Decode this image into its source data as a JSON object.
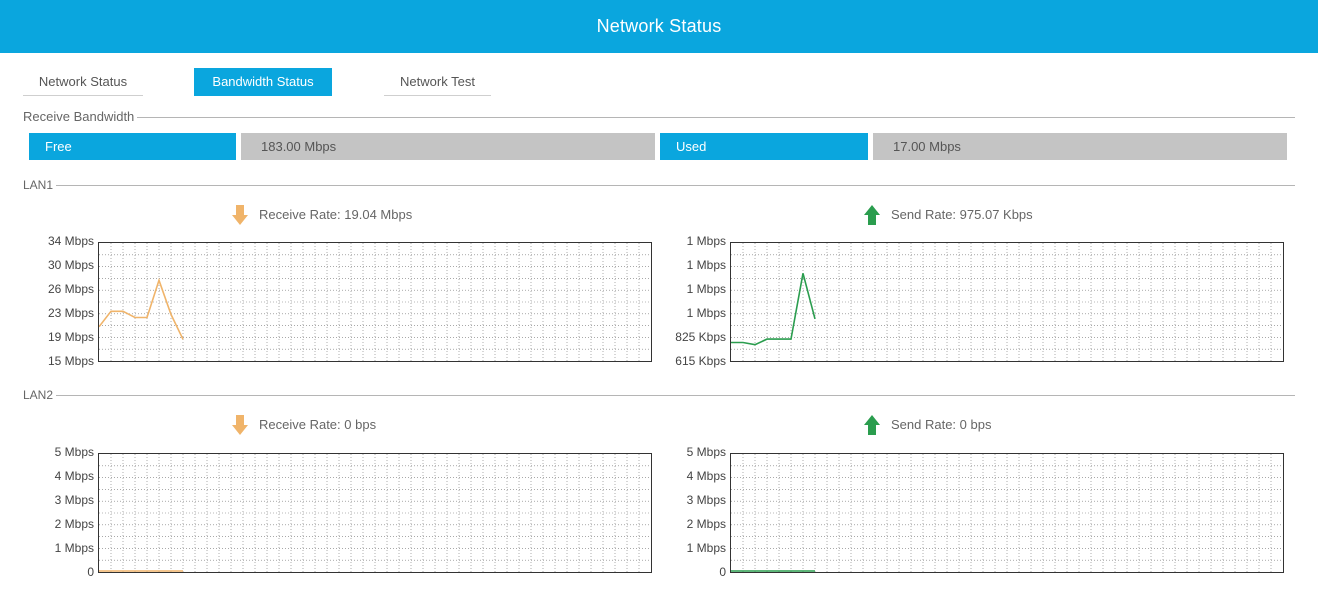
{
  "header": {
    "title": "Network Status"
  },
  "tabs": [
    {
      "label": "Network Status",
      "active": false
    },
    {
      "label": "Bandwidth Status",
      "active": true
    },
    {
      "label": "Network Test",
      "active": false
    }
  ],
  "receive_bandwidth": {
    "section_label": "Receive Bandwidth",
    "free_label": "Free",
    "free_value": "183.00 Mbps",
    "used_label": "Used",
    "used_value": "17.00 Mbps"
  },
  "lan1": {
    "label": "LAN1",
    "receive_rate": "Receive Rate: 19.04 Mbps",
    "send_rate": "Send Rate: 975.07 Kbps"
  },
  "lan2": {
    "label": "LAN2",
    "receive_rate": "Receive Rate: 0 bps",
    "send_rate": "Send Rate: 0 bps"
  },
  "colors": {
    "accent": "#0aa6de",
    "receive": "#f0b46a",
    "send": "#2a9d4e",
    "grey_box": "#c4c4c4"
  },
  "chart_data": [
    {
      "id": "lan1-receive",
      "type": "line",
      "yticks": [
        "34 Mbps",
        "30 Mbps",
        "26 Mbps",
        "23 Mbps",
        "19 Mbps",
        "15 Mbps"
      ],
      "ylim": [
        15,
        34
      ],
      "x": [
        0,
        1,
        2,
        3,
        4,
        5,
        6,
        7
      ],
      "series": [
        {
          "values": [
            20.5,
            23,
            23,
            22,
            22,
            28,
            22.5,
            18.5
          ],
          "color": "#f0b46a"
        }
      ],
      "grid": true
    },
    {
      "id": "lan1-send",
      "type": "line",
      "yticks": [
        "1 Mbps",
        "1 Mbps",
        "1 Mbps",
        "1 Mbps",
        "825 Kbps",
        "615 Kbps"
      ],
      "ylim": [
        615,
        1665
      ],
      "x": [
        0,
        1,
        2,
        3,
        4,
        5,
        6,
        7
      ],
      "series": [
        {
          "values": [
            780,
            780,
            760,
            810,
            810,
            810,
            1395,
            990
          ],
          "color": "#2a9d4e"
        }
      ],
      "grid": true
    },
    {
      "id": "lan2-receive",
      "type": "line",
      "yticks": [
        "5 Mbps",
        "4 Mbps",
        "3 Mbps",
        "2 Mbps",
        "1 Mbps",
        "0"
      ],
      "ylim": [
        0,
        5
      ],
      "x": [
        0,
        1,
        2,
        3,
        4,
        5,
        6,
        7
      ],
      "series": [
        {
          "values": [
            0,
            0,
            0,
            0,
            0,
            0,
            0,
            0
          ],
          "color": "#f0b46a"
        }
      ],
      "grid": true
    },
    {
      "id": "lan2-send",
      "type": "line",
      "yticks": [
        "5 Mbps",
        "4 Mbps",
        "3 Mbps",
        "2 Mbps",
        "1 Mbps",
        "0"
      ],
      "ylim": [
        0,
        5
      ],
      "x": [
        0,
        1,
        2,
        3,
        4,
        5,
        6,
        7
      ],
      "series": [
        {
          "values": [
            0,
            0,
            0,
            0,
            0,
            0,
            0,
            0
          ],
          "color": "#2a9d4e"
        }
      ],
      "grid": true
    }
  ]
}
